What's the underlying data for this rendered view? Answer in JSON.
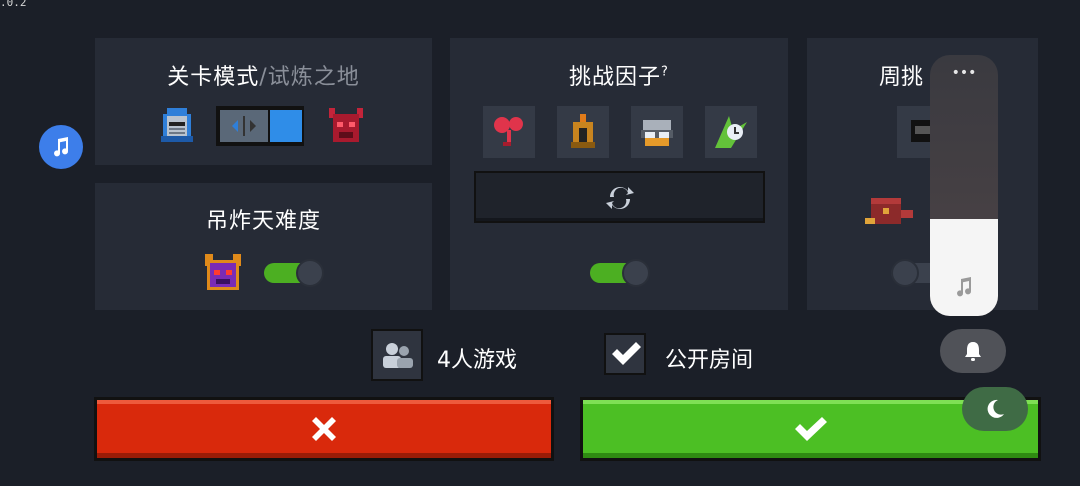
{
  "version": ".0.2",
  "panels": {
    "level_mode": {
      "title": "关卡模式",
      "separator": "/",
      "subtitle": "试炼之地"
    },
    "difficulty": {
      "title": "吊炸天难度",
      "enabled": true
    },
    "challenge": {
      "title": "挑战因子",
      "help": "?",
      "enabled": true
    },
    "weekly": {
      "title": "周挑",
      "enabled": false
    }
  },
  "lobby": {
    "players_label": "4人游戏",
    "public_room_label": "公开房间",
    "public_room_checked": true
  },
  "icons": {
    "music": "music-note-icon",
    "cancel": "cross-icon",
    "confirm": "check-icon",
    "refresh": "refresh-icon",
    "bell": "bell-icon",
    "moon": "moon-icon",
    "more": "more-dots-icon"
  },
  "system_overlay": {
    "volume_level": 0.37,
    "more_label": "•••"
  },
  "colors": {
    "cancel": "#d9290c",
    "confirm": "#4cbf24",
    "toggle_on": "#4caf22",
    "music_bubble": "#3d7eea"
  }
}
